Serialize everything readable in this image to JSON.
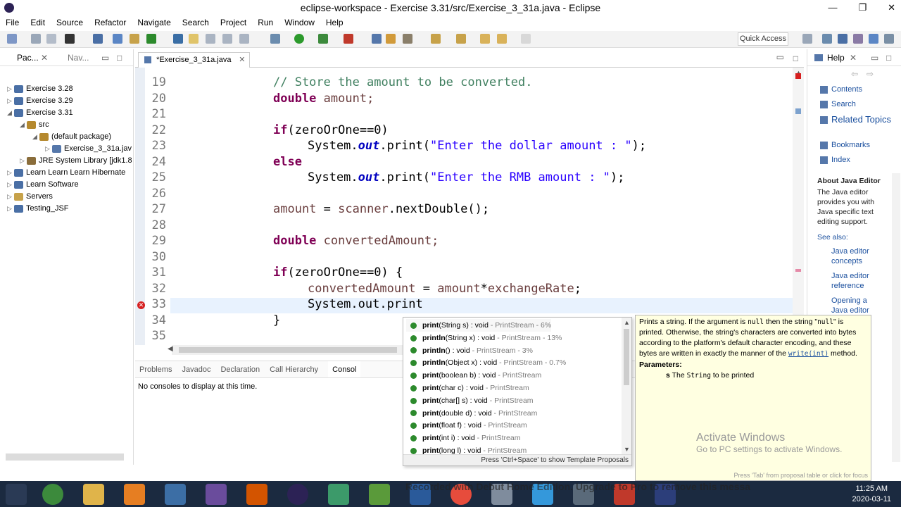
{
  "window": {
    "title": "eclipse-workspace - Exercise 3.31/src/Exercise_3_31a.java - Eclipse",
    "controls": [
      "—",
      "❐",
      "✕"
    ]
  },
  "menu": [
    "File",
    "Edit",
    "Source",
    "Refactor",
    "Navigate",
    "Search",
    "Project",
    "Run",
    "Window",
    "Help"
  ],
  "toolbar": {
    "quick_access": "Quick Access"
  },
  "left_pane": {
    "tabs": [
      "Pac...",
      "Nav..."
    ],
    "tree": [
      {
        "label": "Exercise 3.28",
        "twisty": "▷",
        "indent": 0,
        "color": "#4a6fa5"
      },
      {
        "label": "Exercise 3.29",
        "twisty": "▷",
        "indent": 0,
        "color": "#4a6fa5"
      },
      {
        "label": "Exercise 3.31",
        "twisty": "◢",
        "indent": 0,
        "color": "#4a6fa5"
      },
      {
        "label": "src",
        "twisty": "◢",
        "indent": 1,
        "color": "#b5892e"
      },
      {
        "label": "(default package)",
        "twisty": "◢",
        "indent": 2,
        "color": "#b5892e"
      },
      {
        "label": "Exercise_3_31a.jav",
        "twisty": "▷",
        "indent": 3,
        "color": "#5577aa"
      },
      {
        "label": "JRE System Library [jdk1.8",
        "twisty": "▷",
        "indent": 1,
        "color": "#8a6d3b"
      },
      {
        "label": "Learn Learn Learn Hibernate",
        "twisty": "▷",
        "indent": 0,
        "color": "#4a6fa5"
      },
      {
        "label": "Learn Software",
        "twisty": "▷",
        "indent": 0,
        "color": "#4a6fa5"
      },
      {
        "label": "Servers",
        "twisty": "▷",
        "indent": 0,
        "color": "#c7a24a"
      },
      {
        "label": "Testing_JSF",
        "twisty": "▷",
        "indent": 0,
        "color": "#4a6fa5"
      }
    ]
  },
  "editor": {
    "tab_label": "*Exercise_3_31a.java",
    "lines": [
      {
        "num": "19",
        "indent": 0,
        "tokens": [
          {
            "t": "// Store the amount to be converted.",
            "c": "cm"
          }
        ]
      },
      {
        "num": "20",
        "indent": 0,
        "tokens": [
          {
            "t": "double",
            "c": "kw"
          },
          {
            "t": " amount;",
            "c": "var"
          }
        ]
      },
      {
        "num": "21",
        "indent": 0,
        "tokens": []
      },
      {
        "num": "22",
        "indent": 0,
        "tokens": [
          {
            "t": "if",
            "c": "kw"
          },
          {
            "t": "(zeroOrOne==0)",
            "c": ""
          }
        ]
      },
      {
        "num": "23",
        "indent": 1,
        "tokens": [
          {
            "t": "System.",
            "c": ""
          },
          {
            "t": "out",
            "c": "fld"
          },
          {
            "t": ".print(",
            "c": ""
          },
          {
            "t": "\"Enter the dollar amount : \"",
            "c": "str"
          },
          {
            "t": ");",
            "c": ""
          }
        ]
      },
      {
        "num": "24",
        "indent": 0,
        "tokens": [
          {
            "t": "else",
            "c": "kw"
          }
        ]
      },
      {
        "num": "25",
        "indent": 1,
        "tokens": [
          {
            "t": "System.",
            "c": ""
          },
          {
            "t": "out",
            "c": "fld"
          },
          {
            "t": ".print(",
            "c": ""
          },
          {
            "t": "\"Enter the RMB amount : \"",
            "c": "str"
          },
          {
            "t": ");",
            "c": ""
          }
        ]
      },
      {
        "num": "26",
        "indent": 0,
        "tokens": []
      },
      {
        "num": "27",
        "indent": 0,
        "tokens": [
          {
            "t": "amount",
            "c": "var"
          },
          {
            "t": " = ",
            "c": ""
          },
          {
            "t": "scanner",
            "c": "var"
          },
          {
            "t": ".nextDouble();",
            "c": ""
          }
        ]
      },
      {
        "num": "28",
        "indent": 0,
        "tokens": []
      },
      {
        "num": "29",
        "indent": 0,
        "tokens": [
          {
            "t": "double",
            "c": "kw"
          },
          {
            "t": " convertedAmount;",
            "c": "var"
          }
        ]
      },
      {
        "num": "30",
        "indent": 0,
        "tokens": []
      },
      {
        "num": "31",
        "indent": 0,
        "tokens": [
          {
            "t": "if",
            "c": "kw"
          },
          {
            "t": "(zeroOrOne==0) {",
            "c": ""
          }
        ]
      },
      {
        "num": "32",
        "indent": 1,
        "tokens": [
          {
            "t": "convertedAmount",
            "c": "var"
          },
          {
            "t": " = ",
            "c": ""
          },
          {
            "t": "amount",
            "c": "var"
          },
          {
            "t": "*",
            "c": ""
          },
          {
            "t": "exchangeRate",
            "c": "var"
          },
          {
            "t": ";",
            "c": ""
          }
        ]
      },
      {
        "num": "33",
        "indent": 1,
        "tokens": [
          {
            "t": "System.out.print",
            "c": ""
          }
        ]
      },
      {
        "num": "34",
        "indent": 0,
        "tokens": [
          {
            "t": "}",
            "c": ""
          }
        ]
      },
      {
        "num": "35",
        "indent": 0,
        "tokens": []
      }
    ]
  },
  "console": {
    "tabs": [
      "Problems",
      "Javadoc",
      "Declaration",
      "Call Hierarchy",
      "Consol"
    ],
    "message": "No consoles to display at this time."
  },
  "assist": {
    "proposals": [
      {
        "name": "print",
        "sig": "(String s) : void",
        "type": " - PrintStream - 6%"
      },
      {
        "name": "println",
        "sig": "(String x) : void",
        "type": " - PrintStream - 13%"
      },
      {
        "name": "println",
        "sig": "() : void",
        "type": " - PrintStream - 3%"
      },
      {
        "name": "println",
        "sig": "(Object x) : void",
        "type": " - PrintStream - 0.7%"
      },
      {
        "name": "print",
        "sig": "(boolean b) : void",
        "type": " - PrintStream"
      },
      {
        "name": "print",
        "sig": "(char c) : void",
        "type": " - PrintStream"
      },
      {
        "name": "print",
        "sig": "(char[] s) : void",
        "type": " - PrintStream"
      },
      {
        "name": "print",
        "sig": "(double d) : void",
        "type": " - PrintStream"
      },
      {
        "name": "print",
        "sig": "(float f) : void",
        "type": " - PrintStream"
      },
      {
        "name": "print",
        "sig": "(int i) : void",
        "type": " - PrintStream"
      },
      {
        "name": "print",
        "sig": "(long l) : void",
        "type": " - PrintStream"
      }
    ],
    "footer": "Press 'Ctrl+Space' to show Template Proposals"
  },
  "doc": {
    "p1": "Prints a string. If the argument is ",
    "null1": "null",
    "p2": " then the string \"",
    "null2": "null",
    "p3": "\" is printed. Otherwise, the string's characters are converted into bytes according to the platform's default character encoding, and these bytes are written in exactly the manner of the ",
    "link": "write(int)",
    "p4": " method.",
    "params_title": "Parameters:",
    "param_name": "s",
    "param_desc_a": " The ",
    "param_code": "String",
    "param_desc_b": " to be printed",
    "activate_big": "Activate Windows",
    "activate_small": "Go to PC settings to activate Windows.",
    "footer": "Press 'Tab' from proposal table or click for focus"
  },
  "help": {
    "title": "Help",
    "links": [
      "Contents",
      "Search",
      "Related Topics",
      "Bookmarks",
      "Index"
    ],
    "about_title": "About Java Editor",
    "about_text": "The Java editor provides you with Java specific text editing support.",
    "see_also": "See also:",
    "see_links": [
      "Java editor concepts",
      "Java editor reference",
      "Opening a Java editor"
    ]
  },
  "taskbar": {
    "watermark": "Recorded with Debut Home Edition. Upgrade to Pro to remove this messa",
    "time": "11:25 AM",
    "date": "2020-03-11"
  }
}
